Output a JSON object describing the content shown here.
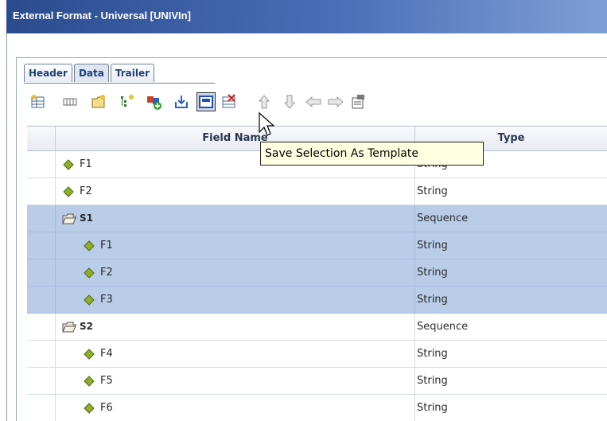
{
  "window": {
    "title": "External Format - Universal [UNIVIn]"
  },
  "tabs": [
    {
      "label": "Header",
      "active": false
    },
    {
      "label": "Data",
      "active": true
    },
    {
      "label": "Trailer",
      "active": false
    }
  ],
  "toolbar": {
    "buttons": [
      {
        "icon": "add-field-icon"
      },
      {
        "icon": "fixed-width-icon"
      },
      {
        "icon": "add-folder-icon"
      },
      {
        "icon": "new-child-icon"
      },
      {
        "icon": "add-template-icon"
      },
      {
        "icon": "import-icon"
      },
      {
        "icon": "save-template-icon"
      },
      {
        "icon": "delete-icon"
      },
      {
        "icon": "move-up-icon"
      },
      {
        "icon": "move-down-icon"
      },
      {
        "icon": "move-left-icon"
      },
      {
        "icon": "move-right-icon"
      },
      {
        "icon": "properties-icon"
      }
    ],
    "tooltip": "Save Selection As Template"
  },
  "grid": {
    "columns": {
      "name": "Field Name",
      "type": "Type"
    },
    "rows": [
      {
        "name": "F1",
        "type": "String",
        "kind": "field",
        "level": 0,
        "selected": false
      },
      {
        "name": "F2",
        "type": "String",
        "kind": "field",
        "level": 0,
        "selected": false
      },
      {
        "name": "S1",
        "type": "Sequence",
        "kind": "sequence",
        "level": 0,
        "selected": true
      },
      {
        "name": "F1",
        "type": "String",
        "kind": "field",
        "level": 1,
        "selected": true
      },
      {
        "name": "F2",
        "type": "String",
        "kind": "field",
        "level": 1,
        "selected": true
      },
      {
        "name": "F3",
        "type": "String",
        "kind": "field",
        "level": 1,
        "selected": true
      },
      {
        "name": "S2",
        "type": "Sequence",
        "kind": "sequence",
        "level": 0,
        "selected": false
      },
      {
        "name": "F4",
        "type": "String",
        "kind": "field",
        "level": 1,
        "selected": false
      },
      {
        "name": "F5",
        "type": "String",
        "kind": "field",
        "level": 1,
        "selected": false
      },
      {
        "name": "F6",
        "type": "String",
        "kind": "field",
        "level": 1,
        "selected": false
      }
    ]
  },
  "colors": {
    "selection": "#b9cde9",
    "field_diamond": "#8fae2a",
    "title_bar": "#2b4b8e"
  }
}
